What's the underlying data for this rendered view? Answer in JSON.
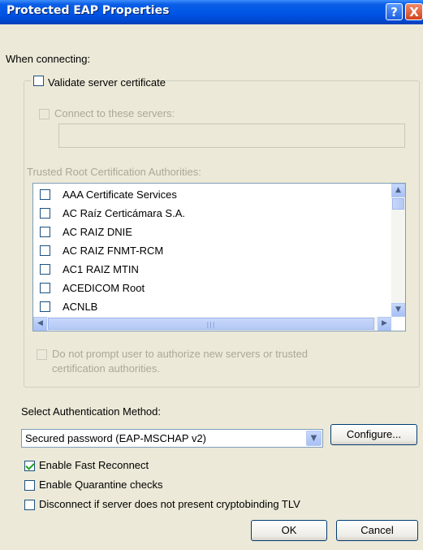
{
  "window": {
    "title": "Protected EAP Properties",
    "help_button": "?",
    "close_button": "X"
  },
  "connecting": {
    "heading": "When connecting:",
    "validate_certificate": {
      "label": "Validate server certificate",
      "checked": false
    },
    "connect_servers": {
      "label": "Connect to these servers:",
      "checked": false,
      "enabled": false,
      "value": ""
    },
    "trusted_root_label": "Trusted Root Certification Authorities:",
    "cert_list": [
      {
        "label": "AAA Certificate Services",
        "checked": false
      },
      {
        "label": "AC Raíz Certicámara S.A.",
        "checked": false
      },
      {
        "label": "AC RAIZ DNIE",
        "checked": false
      },
      {
        "label": "AC RAIZ FNMT-RCM",
        "checked": false
      },
      {
        "label": "AC1 RAIZ MTIN",
        "checked": false
      },
      {
        "label": "ACEDICOM Root",
        "checked": false
      },
      {
        "label": "ACNLB",
        "checked": false
      }
    ],
    "do_not_prompt": {
      "label_line1": "Do not prompt user to authorize new servers or trusted",
      "label_line2": "certification authorities.",
      "checked": false,
      "enabled": false
    }
  },
  "auth": {
    "heading": "Select Authentication Method:",
    "selected_method": "Secured password (EAP-MSCHAP v2)",
    "configure_label": "Configure..."
  },
  "options": [
    {
      "label": "Enable Fast Reconnect",
      "checked": true
    },
    {
      "label": "Enable Quarantine checks",
      "checked": false
    },
    {
      "label": "Disconnect if server does not present cryptobinding TLV",
      "checked": false
    }
  ],
  "buttons": {
    "ok": "OK",
    "cancel": "Cancel"
  },
  "colors": {
    "titlebar": "#0055e5",
    "dialog_bg": "#ece9d8",
    "disabled_text": "#aca899",
    "check_mark": "#21a121"
  }
}
